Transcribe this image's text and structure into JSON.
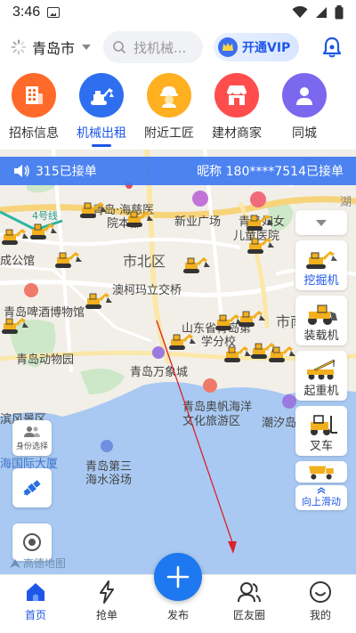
{
  "status": {
    "time": "3:46"
  },
  "header": {
    "city": "青岛市",
    "search_placeholder": "找机械...",
    "vip_label": "开通VIP"
  },
  "categories": [
    {
      "label": "招标信息",
      "color": "#ff6a2b",
      "icon": "building-icon"
    },
    {
      "label": "机械出租",
      "color": "#2e6ff0",
      "icon": "excavator-icon"
    },
    {
      "label": "附近工匠",
      "color": "#ffb020",
      "icon": "worker-icon"
    },
    {
      "label": "建材商家",
      "color": "#ff4d4d",
      "icon": "shop-icon"
    },
    {
      "label": "同城",
      "color": "#7b68ee",
      "icon": "user-icon"
    }
  ],
  "ticker": {
    "left": "315已接单",
    "right": "昵称 180****7514已接单"
  },
  "map": {
    "labels": {
      "l1": "青岛·海慈医",
      "l2": "院本部",
      "l3": "新业广场",
      "l4": "青岛妇女",
      "l5": "儿童医院",
      "l6": "4号线",
      "l7": "成公馆",
      "l8": "市北区",
      "l9": "青岛啤酒博物馆",
      "l10": "澳柯玛立交桥",
      "l11": "山东省青岛第",
      "l12": "学分校",
      "l13": "市南",
      "l14": "青岛动物园",
      "l15": "青岛万象城",
      "l16": "青岛奥帆海洋",
      "l17": "文化旅游区",
      "l18": "潮汐岛",
      "l19": "海国际大厦",
      "l20": "青岛第三",
      "l21": "海水浴场",
      "l22": "滨风景区",
      "l23": "湖",
      "l24": "四实"
    },
    "id_select": "身份选择",
    "gaode": "高德地图"
  },
  "machines": [
    {
      "name": "挖掘机"
    },
    {
      "name": "装载机"
    },
    {
      "name": "起重机"
    },
    {
      "name": "叉车"
    }
  ],
  "swipe_label": "向上滑动",
  "nav": {
    "home": "首页",
    "grab": "抢单",
    "publish": "发布",
    "friends": "匠友圈",
    "mine": "我的"
  }
}
